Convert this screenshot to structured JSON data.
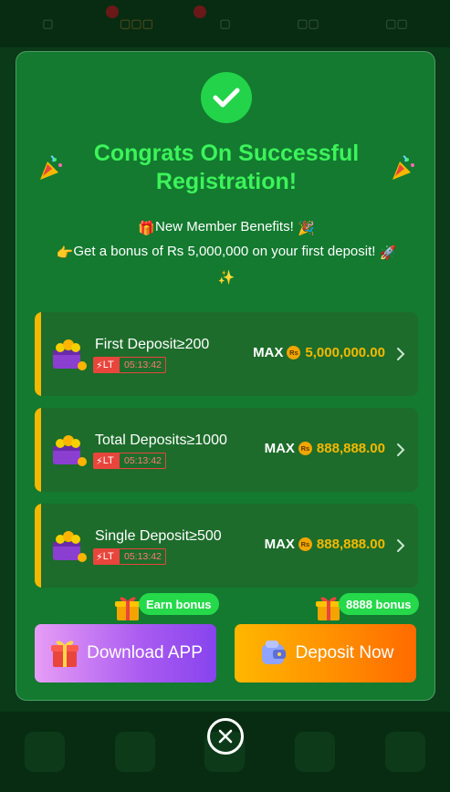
{
  "background": {
    "tabs": [
      "",
      "",
      "",
      "",
      ""
    ],
    "accent": "#1a8a3a"
  },
  "modal": {
    "title": "Congrats On Successful Registration!",
    "benefits_title": "New Member Benefits!",
    "bonus_text": "Get a bonus of Rs 5,000,000 on your first deposit!",
    "tiers": [
      {
        "label": "First Deposit≥200",
        "lt": "LT",
        "timer": "05:13:42",
        "max": "MAX",
        "currency_icon": "Rs",
        "amount": "5,000,000.00"
      },
      {
        "label": "Total Deposits≥1000",
        "lt": "LT",
        "timer": "05:13:42",
        "max": "MAX",
        "currency_icon": "Rs",
        "amount": "888,888.00"
      },
      {
        "label": "Single Deposit≥500",
        "lt": "LT",
        "timer": "05:13:42",
        "max": "MAX",
        "currency_icon": "Rs",
        "amount": "888,888.00"
      }
    ],
    "earn_bonus": "Earn bonus",
    "deposit_bonus": "8888 bonus",
    "download_button": "Download APP",
    "deposit_button": "Deposit Now"
  },
  "colors": {
    "title_green": "#3df35a",
    "gold": "#f5b800",
    "modal_bg": "#137a30"
  }
}
